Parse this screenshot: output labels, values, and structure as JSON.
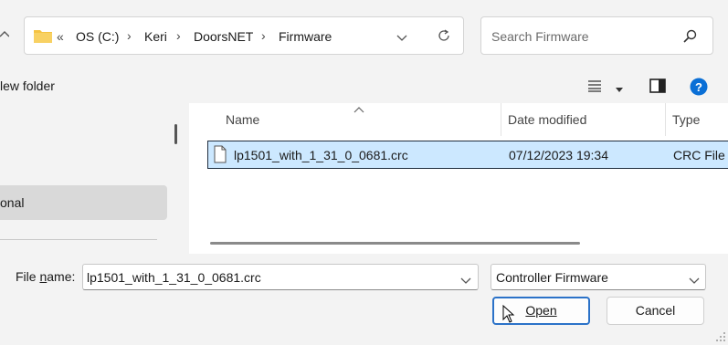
{
  "address": {
    "prefix": "«",
    "crumbs": [
      "OS (C:)",
      "Keri",
      "DoorsNET",
      "Firmware"
    ],
    "separator": "›"
  },
  "search": {
    "placeholder": "Search Firmware"
  },
  "commandbar": {
    "new_folder_label": "lew folder"
  },
  "nav": {
    "selected_item": "onal"
  },
  "columns": {
    "name": "Name",
    "date_modified": "Date modified",
    "type": "Type"
  },
  "files": [
    {
      "name": "lp1501_with_1_31_0_0681.crc",
      "date_modified": "07/12/2023 19:34",
      "type": "CRC File"
    }
  ],
  "footer": {
    "filename_label": "File name:",
    "filename_mnemonic": "n",
    "filename_value": "lp1501_with_1_31_0_0681.crc",
    "filter_value": "Controller Firmware",
    "open_label": "Open",
    "cancel_label": "Cancel"
  },
  "colors": {
    "accent": "#0a6fd6",
    "selection": "#cce8ff",
    "folder": "#f5c342"
  }
}
